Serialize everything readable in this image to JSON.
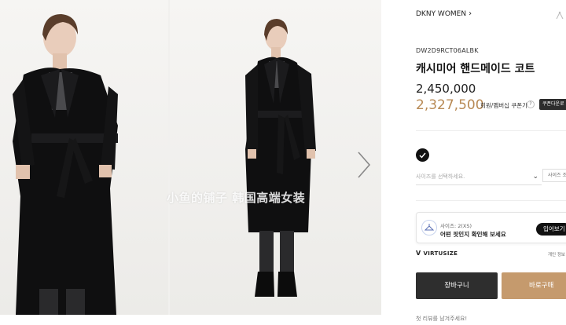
{
  "gallery": {
    "watermark": "小鱼的铺子 韩国高端女装"
  },
  "product": {
    "brand": "DKNY WOMEN",
    "brand_chevron": "›",
    "sku": "DW2D9RCT06ALBK",
    "name": "캐시미어 핸드메이드 코트",
    "price": "2,450,000",
    "sale_price": "2,327,500",
    "sale_label": "회원/멤버십 쿠폰가",
    "help_mark": "?",
    "coupon_button": "쿠폰다운로"
  },
  "options": {
    "size_placeholder": "사이즈를 선택하세요.",
    "size_chevron": "⌄",
    "size_guide": "사이즈 조"
  },
  "virtusize": {
    "size_line": "사이즈: 2(XS)",
    "message": "어떤 핏인지 확인해 보세요",
    "button": "입어보기",
    "logo": "VIRTUSIZE",
    "logo_mark": "V",
    "privacy": "개인 정보"
  },
  "actions": {
    "cart": "장바구니",
    "buy": "바로구매"
  },
  "review": {
    "text": "첫 리뷰를 남겨주세요!"
  },
  "colors": {
    "sale": "#b88a55",
    "buy_button": "#c59a6d",
    "cart_button": "#2e2e2e"
  }
}
